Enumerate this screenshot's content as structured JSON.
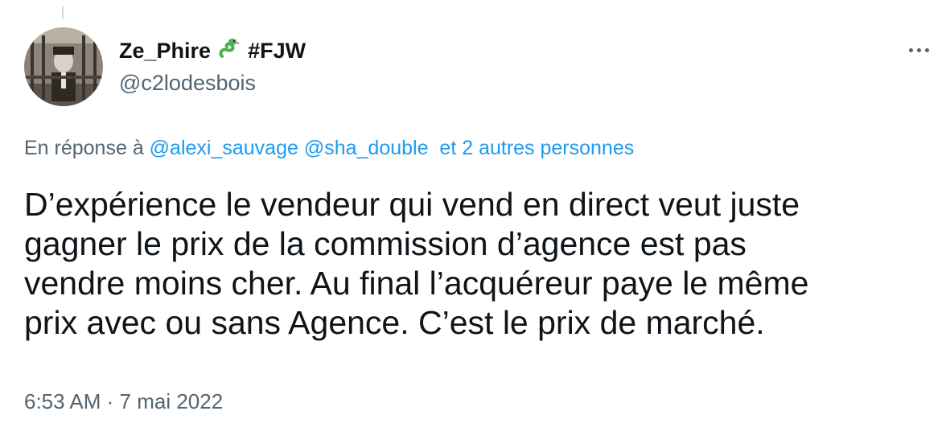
{
  "author": {
    "display_name": "Ze_Phire",
    "badge_icon": "snake-emoji-icon",
    "tag": "#FJW",
    "handle": "@c2lodesbois"
  },
  "reply_to": {
    "prefix": "En réponse à",
    "mentions": [
      "@alexi_sauvage",
      "@sha_double"
    ],
    "others": "et 2 autres personnes"
  },
  "tweet": {
    "lines": [
      "D’expérience le vendeur qui vend en direct veut juste",
      "gagner le prix de la commission d’agence est pas",
      "vendre moins cher. Au final l’acquéreur paye le même",
      "prix avec ou sans Agence. C’est le prix de marché."
    ]
  },
  "meta": {
    "time": "6:53 AM",
    "separator": "·",
    "date": "7 mai 2022"
  },
  "colors": {
    "link": "#1d9bf0",
    "secondary": "#536471",
    "text": "#0f1419",
    "snake": "#4caf50"
  }
}
